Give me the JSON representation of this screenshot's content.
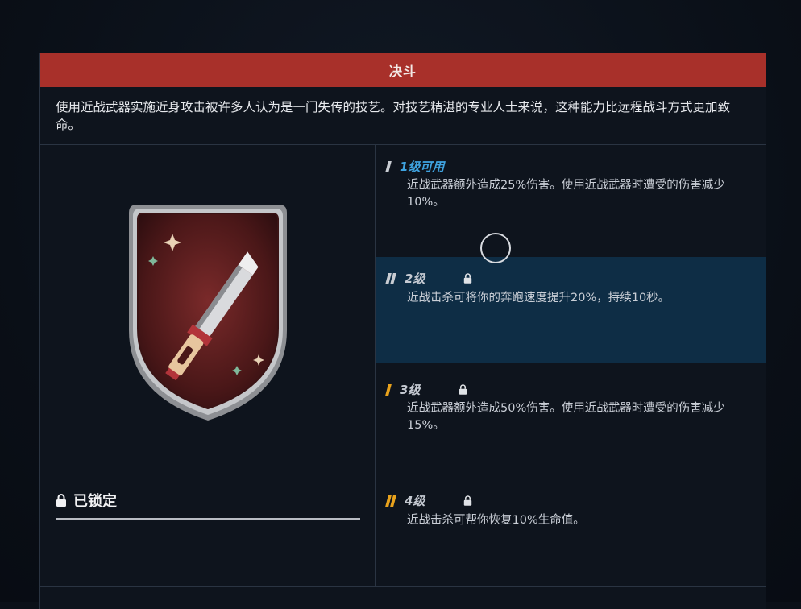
{
  "panel": {
    "title": "决斗",
    "description": "使用近战武器实施近身攻击被许多人认为是一门失传的技艺。对技艺精湛的专业人士来说，这种能力比远程战斗方式更加致命。"
  },
  "status": {
    "icon": "lock-icon",
    "label": "已锁定"
  },
  "tiers": [
    {
      "label": "1级可用",
      "text": "近战武器额外造成25%伤害。使用近战武器时遭受的伤害减少10%。",
      "mark_color": "#c8ccd2",
      "locked": false
    },
    {
      "label": "2级",
      "text": "近战击杀可将你的奔跑速度提升20%，持续10秒。",
      "mark_color": "#c8ccd2",
      "locked": true
    },
    {
      "label": "3级",
      "text": "近战武器额外造成50%伤害。使用近战武器时遭受的伤害减少15%。",
      "mark_color": "#e8a21c",
      "locked": true
    },
    {
      "label": "4级",
      "text": "近战击杀可帮你恢复10%生命值。",
      "mark_color": "#e8a21c",
      "locked": true
    }
  ],
  "colors": {
    "title_bar": "#a8302a",
    "available": "#3fa3e0",
    "highlight_row": "#0e2d45"
  }
}
